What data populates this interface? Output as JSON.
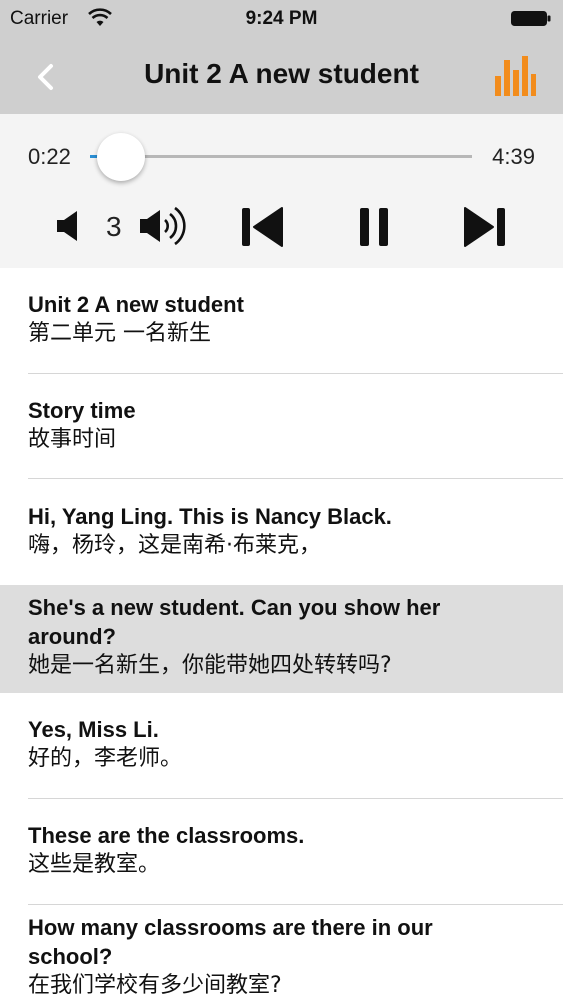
{
  "status": {
    "carrier": "Carrier",
    "time": "9:24 PM"
  },
  "nav": {
    "title": "Unit 2 A new student",
    "back_icon": "chevron-left-icon",
    "stats_icon": "bar-chart-icon",
    "accent": "#f28c1c"
  },
  "player": {
    "current_time": "0:22",
    "total_time": "4:39",
    "progress": 0.08,
    "volume_level": "3"
  },
  "lines": [
    {
      "en": "Unit 2 A new student",
      "cn": "第二单元 一名新生",
      "highlighted": false
    },
    {
      "en": "Story time",
      "cn": "故事时间",
      "highlighted": false
    },
    {
      "en": "Hi, Yang Ling. This is Nancy Black.",
      "cn": "嗨，杨玲，这是南希·布莱克，",
      "highlighted": false
    },
    {
      "en": "She's a new student. Can you show her around?",
      "cn": "她是一名新生，你能带她四处转转吗?",
      "highlighted": true
    },
    {
      "en": "Yes, Miss Li.",
      "cn": "好的，李老师。",
      "highlighted": false
    },
    {
      "en": "These are the classrooms.",
      "cn": "这些是教室。",
      "highlighted": false
    },
    {
      "en": "How many classrooms are there in our school?",
      "cn": "在我们学校有多少间教室?",
      "highlighted": false
    }
  ]
}
